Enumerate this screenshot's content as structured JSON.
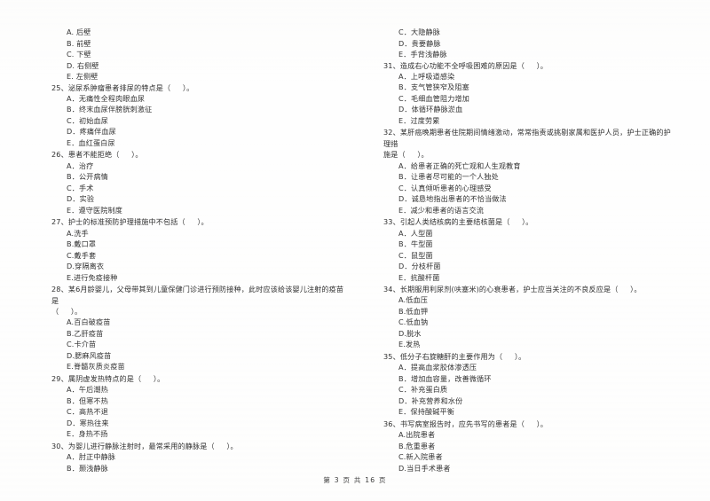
{
  "document": {
    "type": "exam-paper",
    "language": "zh-CN",
    "footer": "第 3 页 共 16 页"
  },
  "left_column": {
    "continued_options": [
      "A. 后壁",
      "B. 前壁",
      "C. 下壁",
      "D. 右侧壁",
      "E. 左侧壁"
    ],
    "questions": [
      {
        "number": "25",
        "stem": "25、泌尿系肿瘤患者排尿的特点是（     ）。",
        "options": [
          "A．无痛性全程肉眼血尿",
          "B．终末血尿伴膀胱刺激征",
          "C．初始血尿",
          "D．疼痛伴血尿",
          "E．血红蛋白尿"
        ]
      },
      {
        "number": "26",
        "stem": "26、患者不能拒绝（     ）。",
        "options": [
          "A．治疗",
          "B．公开病情",
          "C．手术",
          "D．实验",
          "E．遵守医院制度"
        ]
      },
      {
        "number": "27",
        "stem": "27、护士的标准预防护理措施中不包括（     ）。",
        "options": [
          "A.洗手",
          "B.戴口罩",
          "C.戴手套",
          "D.穿隔离衣",
          "E.进行免疫接种"
        ]
      },
      {
        "number": "28",
        "stem": "28、某6月龄婴儿，父母带其到儿童保健门诊进行预防接种，此时应该给该婴儿注射的疫苗是\n（     ）。",
        "options": [
          "A.百白破疫苗",
          "B.乙肝疫苗",
          "C.卡介苗",
          "D.腮麻风疫苗",
          "E.脊髓灰质炎疫苗"
        ]
      },
      {
        "number": "29",
        "stem": "29、属阴虚发热特点的是（     ）。",
        "options": [
          "A．午后潮热",
          "B．但寒不热",
          "C．高热不退",
          "D．寒热往来",
          "E．身热不扬"
        ]
      },
      {
        "number": "30",
        "stem": "30、为婴儿进行静脉注射时，最常采用的静脉是（     ）。",
        "options": [
          "A．肘正中静脉",
          "B．颞浅静脉"
        ]
      }
    ]
  },
  "right_column": {
    "continued_options": [
      "C．大隐静脉",
      "D．贵要静脉",
      "E．手背浅静脉"
    ],
    "questions": [
      {
        "number": "31",
        "stem": "31、造成右心功能不全呼吸困难的原因是（     ）。",
        "options": [
          "A．上呼吸道感染",
          "B．支气管狭窄及阻塞",
          "C．毛细血管阻力增加",
          "D．体循环静脉淤血",
          "E．过度劳累"
        ]
      },
      {
        "number": "32",
        "stem": "32、某肝癌晚期患者住院期间情绪激动，常常指责或挑剔家属和医护人员，护士正确的护理措\n施是（     ）。",
        "options": [
          "A．给患者正确的死亡观和人生观教育",
          "B．让患者尽可能的一个人独处",
          "C．认真倾听患者的心理感受",
          "D．诚恳地指出患者的不恰当做法",
          "E．减少和患者的语言交流"
        ]
      },
      {
        "number": "33",
        "stem": "33、引起人类结核病的主要结核菌是（     ）。",
        "options": [
          "A．人型菌",
          "B．牛型菌",
          "C．鼠型菌",
          "D．分枝杆菌",
          "E．抗酸杆菌"
        ]
      },
      {
        "number": "34",
        "stem": "34、长期服用利尿剂(呋塞米)的心衰患者，护士应当关注的不良反应是（     ）。",
        "options": [
          "A.低血压",
          "B.低血钾",
          "C.低血钠",
          "D.脱水",
          "E.发热"
        ]
      },
      {
        "number": "35",
        "stem": "35、低分子右旋糖酐的主要作用为（     ）。",
        "options": [
          "A．提高血浆胶体渗透压",
          "B．增加血容量，改善微循环",
          "C．补充蛋白质",
          "D．补充营养和水份",
          "E．保持酸碱平衡"
        ]
      },
      {
        "number": "36",
        "stem": "36、书写病室报告时，应先书写的患者是（     ）。",
        "options": [
          "A.出院患者",
          "B.危重患者",
          "C.新入院患者",
          "D.当日手术患者"
        ]
      }
    ]
  }
}
